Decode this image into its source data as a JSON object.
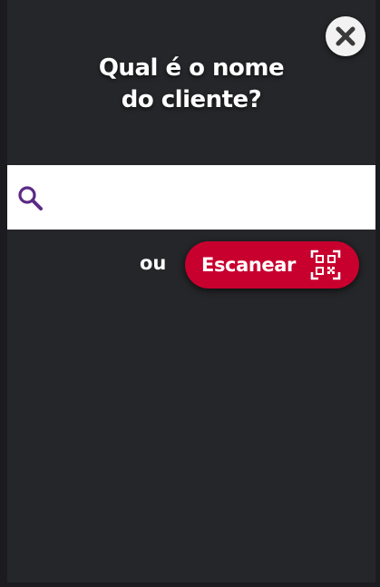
{
  "modal": {
    "title": "Qual é o nome\ndo cliente?",
    "close_icon": "close-icon"
  },
  "search": {
    "icon": "search-icon",
    "value": "",
    "placeholder": ""
  },
  "scan": {
    "or_label": "ou",
    "button_label": "Escanear",
    "icon": "qr-code-icon"
  },
  "colors": {
    "background": "#252629",
    "accent": "#c8002e",
    "search_icon": "#5b2a86",
    "text": "#ffffff"
  }
}
